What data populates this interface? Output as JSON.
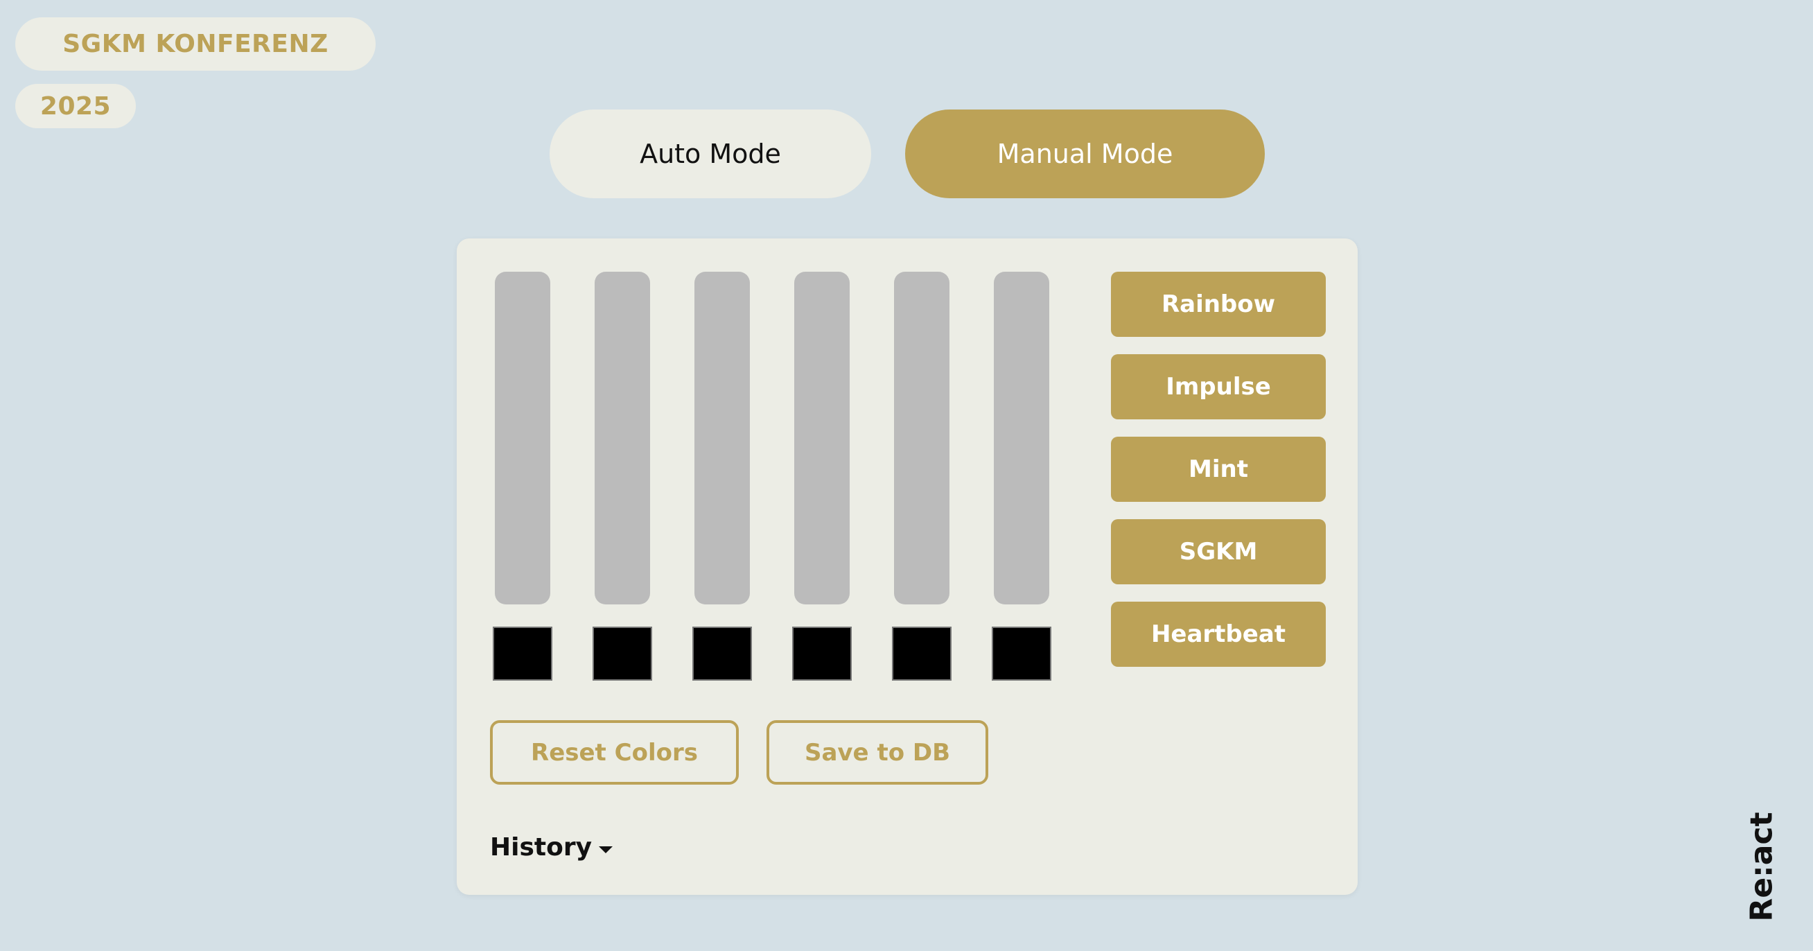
{
  "header": {
    "title": "SGKM KONFERENZ",
    "year": "2025"
  },
  "modes": {
    "auto_label": "Auto Mode",
    "manual_label": "Manual Mode",
    "active": "manual"
  },
  "controls": {
    "sliders": [
      {
        "value": 0,
        "swatch_color": "#000000"
      },
      {
        "value": 0,
        "swatch_color": "#000000"
      },
      {
        "value": 0,
        "swatch_color": "#000000"
      },
      {
        "value": 0,
        "swatch_color": "#000000"
      },
      {
        "value": 0,
        "swatch_color": "#000000"
      },
      {
        "value": 0,
        "swatch_color": "#000000"
      }
    ],
    "presets": [
      "Rainbow",
      "Impulse",
      "Mint",
      "SGKM",
      "Heartbeat"
    ],
    "reset_label": "Reset Colors",
    "save_label": "Save to DB",
    "history_label": "History"
  },
  "brand": {
    "logo_text": "Re:act"
  },
  "colors": {
    "background": "#d4e0e6",
    "accent": "#bca257",
    "panel": "#ecede5",
    "track": "#bbbbbb"
  }
}
